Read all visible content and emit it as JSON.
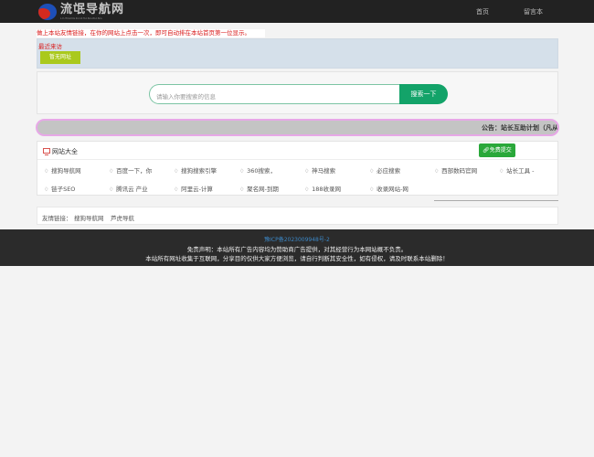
{
  "header": {
    "logo_text": "流氓导航网",
    "logo_sub": "LIUMANGDAOHANGWANG",
    "nav": [
      "首页",
      "留言本"
    ]
  },
  "notice_tip": "做上本站友情链接，在你的网站上点击一次，即可自动排在本站首页第一位显示。",
  "recent": {
    "title": "最近来访",
    "button": "暂无网址"
  },
  "search": {
    "placeholder": "请输入你要搜索的信息",
    "button": "搜索一下"
  },
  "marquee": "公告：站长互助计划（凡从",
  "sites": {
    "title": "网站大全",
    "submit_button": "免费提交",
    "items": [
      "搜狗导航网",
      "百度一下，你",
      "搜狗搜索引擎",
      "360搜索，",
      "神马搜索",
      "必应搜索",
      "西部数码官网",
      "站长工具 -",
      "链子SEO",
      "腾讯云 产业",
      "阿里云-计算",
      "聚名网-到期",
      "188收录网",
      "收录网站-网"
    ]
  },
  "friend_links": {
    "label": "友情链接：",
    "items": [
      "搜狗导航网",
      "芦虎导航"
    ]
  },
  "footer": {
    "icp": "豫ICP备2023009948号-2",
    "line1": "免责声明：本站所有广告内容均为赞助商广告提供，对其经营行为本网站概不负责。",
    "line2": "本站所有网址收集于互联网，分享目的仅供大家方便浏览，请自行判断其安全性，如有侵权，请及时联系本站删除！"
  },
  "icons": {
    "site": "thumbs-up-icon",
    "sites_header": "monitor-icon",
    "submit": "link-icon"
  },
  "colors": {
    "accent_green": "#13a369",
    "warning_red": "#d91a1a",
    "recent_button": "#aac91d",
    "submit_button": "#2aa83a"
  }
}
